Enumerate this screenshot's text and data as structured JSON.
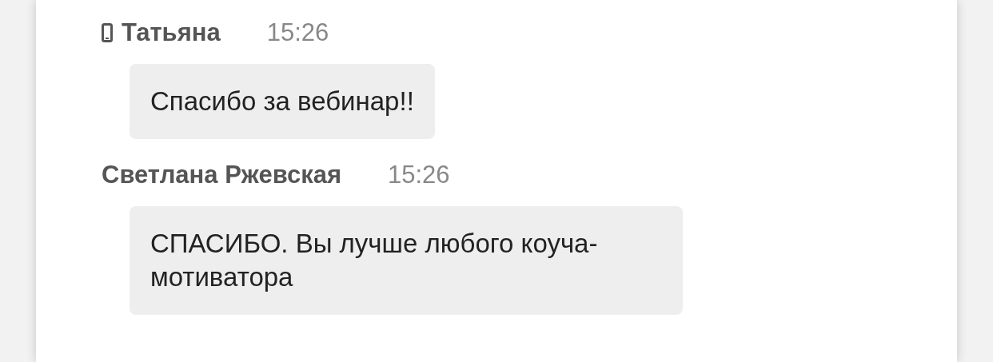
{
  "messages": [
    {
      "author": "Татьяна",
      "from_mobile": true,
      "time": "15:26",
      "text": "Спасибо за вебинар!!"
    },
    {
      "author": "Светлана Ржевская",
      "from_mobile": false,
      "time": "15:26",
      "text": "СПАСИБО. Вы лучше любого коуча-мотиватора"
    }
  ]
}
